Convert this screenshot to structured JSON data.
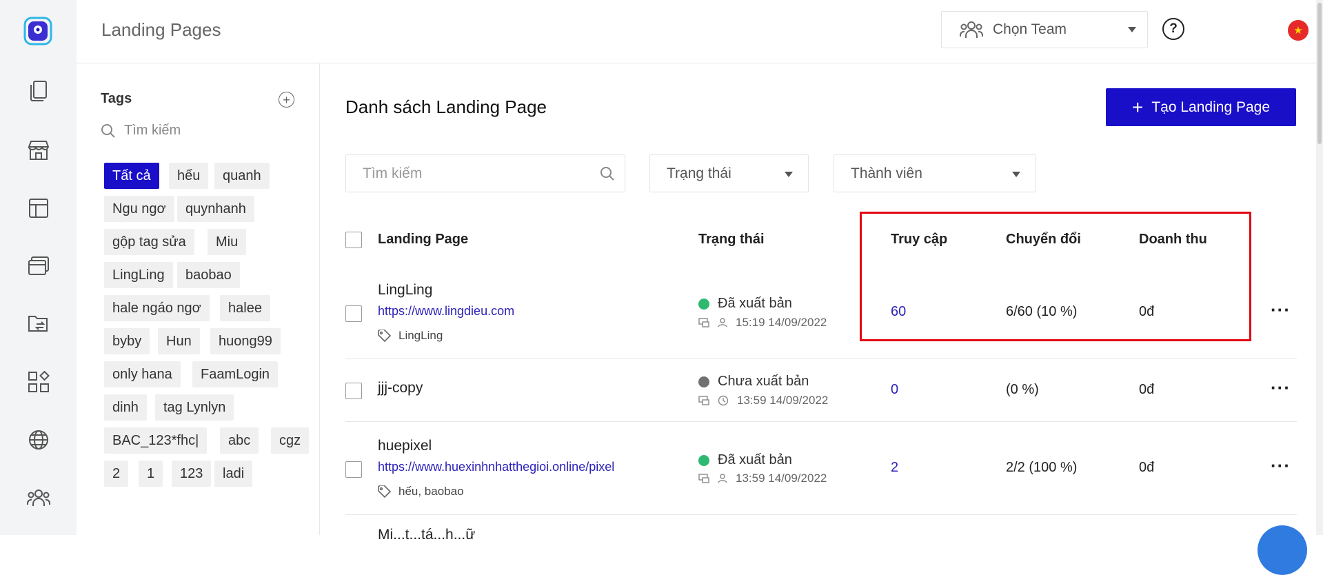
{
  "header": {
    "page_title": "Landing Pages",
    "team_select": "Chọn Team",
    "help_glyph": "?",
    "flag_glyph": "★"
  },
  "tags_panel": {
    "title": "Tags",
    "search_placeholder": "Tìm kiếm",
    "tags": [
      "Tất cả",
      "hếu",
      "quanh",
      "Ngu ngơ",
      "quynhanh",
      "gộp tag sửa",
      "Miu",
      "LingLing",
      "baobao",
      "hale ngáo ngơ",
      "halee",
      "byby",
      "Hun",
      "huong99",
      "only hana",
      "FaamLogin",
      "dinh",
      "tag Lynlyn",
      "BAC_123*fhc|",
      "abc",
      "cgz",
      "2",
      "1",
      "123",
      "ladi"
    ],
    "active_tag": "Tất cả"
  },
  "main": {
    "title": "Danh sách Landing Page",
    "create_button": "Tạo Landing Page",
    "create_icon": "+",
    "search_placeholder": "Tìm kiếm",
    "filter_status": "Trạng thái",
    "filter_member": "Thành viên",
    "columns": {
      "landing_page": "Landing Page",
      "status": "Trạng thái",
      "visits": "Truy cập",
      "conversions": "Chuyển đổi",
      "revenue": "Doanh thu"
    },
    "rows": [
      {
        "name": "LingLing",
        "url": "https://www.lingdieu.com",
        "tags": "LingLing",
        "status": "Đã xuất bản",
        "status_color": "#2eb872",
        "time": "15:19 14/09/2022",
        "visits": "60",
        "conversions": "6/60 (10 %)",
        "revenue": "0đ"
      },
      {
        "name": "jjj-copy",
        "url": "",
        "tags": "",
        "status": "Chưa xuất bản",
        "status_color": "#707070",
        "time": "13:59 14/09/2022",
        "visits": "0",
        "conversions": "(0 %)",
        "revenue": "0đ"
      },
      {
        "name": "huepixel",
        "url": "https://www.huexinhnhatthegioi.online/pixel",
        "tags": "hếu,  baobao",
        "status": "Đã xuất bản",
        "status_color": "#2eb872",
        "time": "13:59 14/09/2022",
        "visits": "2",
        "conversions": "2/2 (100 %)",
        "revenue": "0đ"
      }
    ],
    "partial_row": "Mi...t...tá...h...ữ",
    "row_menu": "···"
  },
  "colors": {
    "accent": "#1a0fc9",
    "highlight": "#e30613",
    "published": "#2eb872",
    "draft": "#707070"
  }
}
